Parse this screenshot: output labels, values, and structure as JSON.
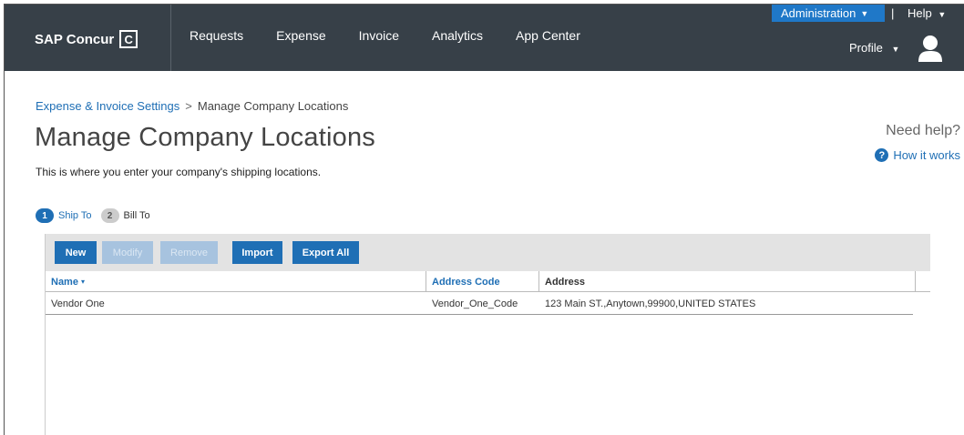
{
  "header": {
    "brand": "SAP Concur",
    "brand_mark": "C",
    "nav": [
      "Requests",
      "Expense",
      "Invoice",
      "Analytics",
      "App Center"
    ],
    "administration": "Administration",
    "separator": "|",
    "help": "Help",
    "profile": "Profile",
    "colors": {
      "bar": "#374048",
      "admin": "#1f78c8"
    }
  },
  "breadcrumb": {
    "parent": "Expense & Invoice Settings",
    "separator": ">",
    "current": "Manage Company Locations"
  },
  "page": {
    "title": "Manage Company Locations",
    "subtitle": "This is where you enter your company's shipping locations."
  },
  "help_panel": {
    "need_help": "Need help?",
    "how_it_works": "How it works",
    "icon": "question-circle-icon"
  },
  "steps": [
    {
      "num": "1",
      "label": "Ship To",
      "active": true
    },
    {
      "num": "2",
      "label": "Bill To",
      "active": false
    }
  ],
  "toolbar": {
    "new": "New",
    "modify": "Modify",
    "remove": "Remove",
    "import": "Import",
    "export_all": "Export All"
  },
  "table": {
    "columns": {
      "name": "Name",
      "sort_indicator": "▾",
      "address_code": "Address Code",
      "address": "Address"
    },
    "rows": [
      {
        "name": "Vendor One",
        "address_code": "Vendor_One_Code",
        "address": "123 Main ST.,Anytown,99900,UNITED STATES"
      }
    ]
  },
  "accent_color": "#1f6fb5"
}
